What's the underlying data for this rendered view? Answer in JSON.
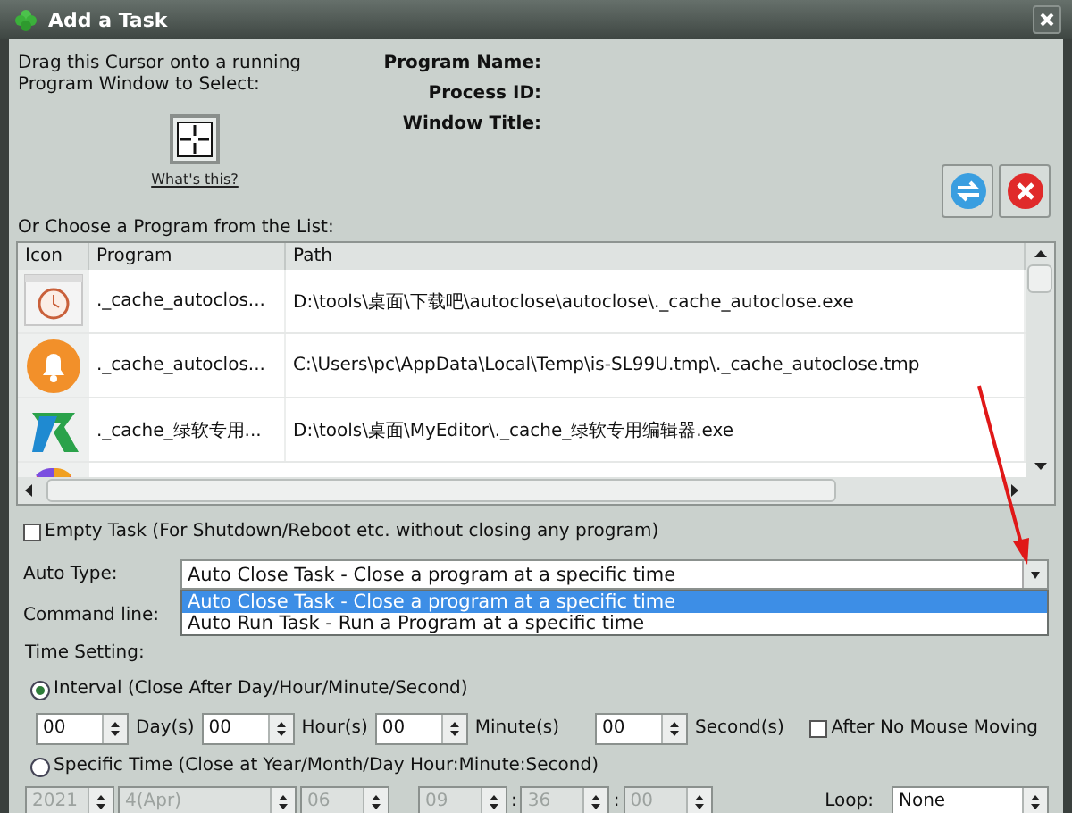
{
  "window": {
    "title": "Add a Task"
  },
  "drag_hint": "Drag this Cursor onto a running Program Window to Select:",
  "help_link": "What's this?",
  "info_labels": [
    "Program Name:",
    "Process ID:",
    "Window Title:"
  ],
  "list_label": "Or Choose a Program from the List:",
  "table": {
    "columns": [
      "Icon",
      "Program",
      "Path"
    ],
    "rows": [
      {
        "kind": "clock",
        "program": "._cache_autoclos...",
        "path": "D:\\tools\\桌面\\下载吧\\autoclose\\autoclose\\._cache_autoclose.exe"
      },
      {
        "kind": "bell",
        "program": "._cache_autoclos...",
        "path": "C:\\Users\\pc\\AppData\\Local\\Temp\\is-SL99U.tmp\\._cache_autoclose.tmp"
      },
      {
        "kind": "logo",
        "program": "._cache_绿软专用...",
        "path": "D:\\tools\\桌面\\MyEditor\\._cache_绿软专用编辑器.exe"
      }
    ]
  },
  "empty_task": {
    "label": "Empty Task (For Shutdown/Reboot etc. without closing any program)",
    "checked": false
  },
  "auto_type": {
    "label": "Auto Type:",
    "value": "Auto Close Task - Close a program at a specific time",
    "expanded": true,
    "options": [
      {
        "label": "Auto Close Task - Close a program at a specific time",
        "selected": true
      },
      {
        "label": "Auto Run Task - Run a Program at a specific time",
        "selected": false
      }
    ]
  },
  "command_line": {
    "label": "Command line:"
  },
  "time_setting": {
    "label": "Time Setting:",
    "interval": {
      "label": "Interval (Close After Day/Hour/Minute/Second)",
      "selected": true
    },
    "interval_fields": [
      {
        "value": "00",
        "unit": "Day(s)"
      },
      {
        "value": "00",
        "unit": "Hour(s)"
      },
      {
        "value": "00",
        "unit": "Minute(s)"
      },
      {
        "value": "00",
        "unit": "Second(s)"
      }
    ],
    "no_mouse": {
      "label": "After No Mouse Moving",
      "checked": false
    },
    "specific": {
      "label": "Specific Time (Close at Year/Month/Day Hour:Minute:Second)",
      "selected": false
    },
    "specific_disabled": true,
    "specific_fields": [
      {
        "kind": "spin",
        "value": "2021"
      },
      {
        "kind": "wide",
        "value": "4(Apr)"
      },
      {
        "kind": "spin",
        "value": "06"
      },
      {
        "kind": "gap"
      },
      {
        "kind": "spin",
        "value": "09"
      },
      {
        "kind": "sep",
        "text": ":"
      },
      {
        "kind": "spin",
        "value": "36"
      },
      {
        "kind": "sep",
        "text": ":"
      },
      {
        "kind": "spin",
        "value": "00"
      }
    ],
    "loop": {
      "label": "Loop:",
      "value": "None"
    }
  }
}
